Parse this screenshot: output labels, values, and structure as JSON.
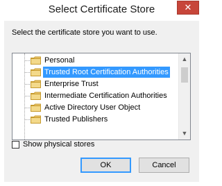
{
  "window": {
    "title": "Select Certificate Store",
    "close_glyph": "✕"
  },
  "instruction": "Select the certificate store you want to use.",
  "stores": [
    {
      "label": "Personal",
      "selected": false
    },
    {
      "label": "Trusted Root Certification Authorities",
      "selected": true
    },
    {
      "label": "Enterprise Trust",
      "selected": false
    },
    {
      "label": "Intermediate Certification Authorities",
      "selected": false
    },
    {
      "label": "Active Directory User Object",
      "selected": false
    },
    {
      "label": "Trusted Publishers",
      "selected": false
    }
  ],
  "scrollbar": {
    "up_glyph": "▲",
    "down_glyph": "▼"
  },
  "show_physical_stores": {
    "label": "Show physical stores",
    "checked": false
  },
  "buttons": {
    "ok": "OK",
    "cancel": "Cancel"
  },
  "colors": {
    "selection": "#3399ff",
    "close_button": "#c7463a",
    "folder": "#e9c46a"
  },
  "icons": {
    "folder": "folder-icon",
    "close": "close-icon"
  }
}
